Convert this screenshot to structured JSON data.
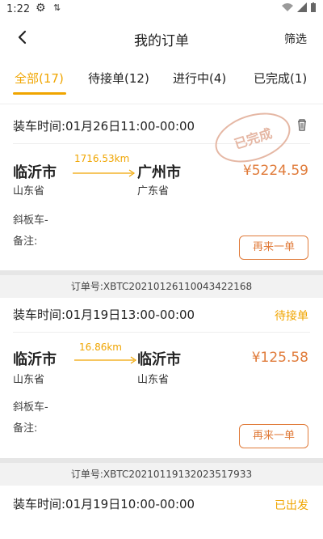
{
  "status_bar": {
    "time": "1:22"
  },
  "header": {
    "title": "我的订单",
    "filter": "筛选"
  },
  "tabs": [
    {
      "label": "全部(17)"
    },
    {
      "label": "待接单(12)"
    },
    {
      "label": "进行中(4)"
    },
    {
      "label": "已完成(1)"
    }
  ],
  "orders": [
    {
      "load_time": "装车时间:01月26日11:00-00:00",
      "stamp": "已完成",
      "from_city": "临沂市",
      "from_prov": "山东省",
      "distance": "1716.53km",
      "to_city": "广州市",
      "to_prov": "广东省",
      "price": "¥5224.59",
      "vehicle": "斜板车-",
      "remark": "备注:",
      "reorder": "再来一单",
      "order_no": "订单号:XBTC20210126110043422168"
    },
    {
      "load_time": "装车时间:01月19日13:00-00:00",
      "status": "待接单",
      "from_city": "临沂市",
      "from_prov": "山东省",
      "distance": "16.86km",
      "to_city": "临沂市",
      "to_prov": "山东省",
      "price": "¥125.58",
      "vehicle": "斜板车-",
      "remark": "备注:",
      "reorder": "再来一单",
      "order_no": "订单号:XBTC20210119132023517933"
    },
    {
      "load_time": "装车时间:01月19日10:00-00:00",
      "status": "已出发"
    }
  ],
  "colors": {
    "accent": "#f0a500",
    "price": "#e07b3a"
  }
}
